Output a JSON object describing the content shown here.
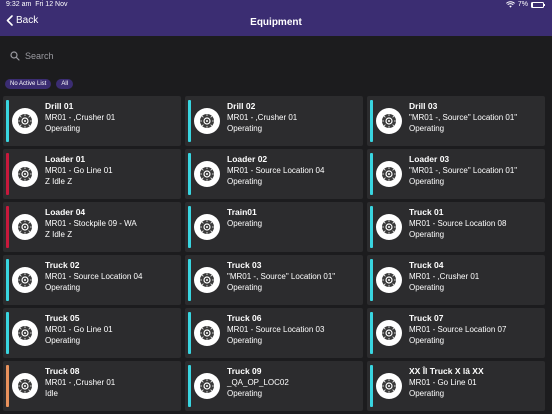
{
  "status_bar": {
    "time": "9:32 am",
    "date": "Fri 12 Nov",
    "battery": "7%",
    "battery_level": 0.07
  },
  "header": {
    "back_label": "Back",
    "title": "Equipment"
  },
  "search": {
    "placeholder": "Search"
  },
  "filters": [
    {
      "label": "No Active List"
    },
    {
      "label": "All"
    }
  ],
  "colors": {
    "header": "#3b2d72",
    "cyan": "#39d5e0",
    "red": "#c8193c",
    "orange": "#e8915c"
  },
  "equipment": [
    {
      "name": "Drill 01",
      "line1": "MR01 - ,Crusher 01",
      "line2": "Operating",
      "status_color": "#39d5e0"
    },
    {
      "name": "Drill 02",
      "line1": "MR01 - ,Crusher 01",
      "line2": "Operating",
      "status_color": "#39d5e0"
    },
    {
      "name": "Drill 03",
      "line1": "\"MR01 -, Source\" Location 01\"",
      "line2": "Operating",
      "status_color": "#39d5e0"
    },
    {
      "name": "Loader 01",
      "line1": "MR01 - Go Line 01",
      "line2": "Z Idle Z",
      "status_color": "#c8193c"
    },
    {
      "name": "Loader 02",
      "line1": "MR01 - Source Location 04",
      "line2": "Operating",
      "status_color": "#39d5e0"
    },
    {
      "name": "Loader 03",
      "line1": "\"MR01 -, Source\" Location 01\"",
      "line2": "Operating",
      "status_color": "#39d5e0"
    },
    {
      "name": "Loader 04",
      "line1": "MR01 - Stockpile 09 - WA",
      "line2": "Z Idle Z",
      "status_color": "#c8193c"
    },
    {
      "name": "Train01",
      "line1": "Operating",
      "line2": "",
      "status_color": "#39d5e0"
    },
    {
      "name": "Truck 01",
      "line1": "MR01 - Source Location 08",
      "line2": "Operating",
      "status_color": "#39d5e0"
    },
    {
      "name": "Truck 02",
      "line1": "MR01 - Source Location 04",
      "line2": "Operating",
      "status_color": "#39d5e0"
    },
    {
      "name": "Truck 03",
      "line1": "\"MR01 -, Source\" Location 01\"",
      "line2": "Operating",
      "status_color": "#39d5e0"
    },
    {
      "name": "Truck 04",
      "line1": "MR01 - ,Crusher 01",
      "line2": "Operating",
      "status_color": "#39d5e0"
    },
    {
      "name": "Truck 05",
      "line1": "MR01 - Go Line 01",
      "line2": "Operating",
      "status_color": "#39d5e0"
    },
    {
      "name": "Truck 06",
      "line1": "MR01 - Source Location 03",
      "line2": "Operating",
      "status_color": "#39d5e0"
    },
    {
      "name": "Truck 07",
      "line1": "MR01 - Source Location 07",
      "line2": "Operating",
      "status_color": "#39d5e0"
    },
    {
      "name": "Truck 08",
      "line1": "MR01 - ,Crusher 01",
      "line2": "Idle",
      "status_color": "#e8915c"
    },
    {
      "name": "Truck 09",
      "line1": "_QA_OP_LOC02",
      "line2": "Operating",
      "status_color": "#39d5e0"
    },
    {
      "name": "XX Îl Truck X lâ XX",
      "line1": "MR01 - Go Line 01",
      "line2": "Operating",
      "status_color": "#39d5e0"
    }
  ]
}
